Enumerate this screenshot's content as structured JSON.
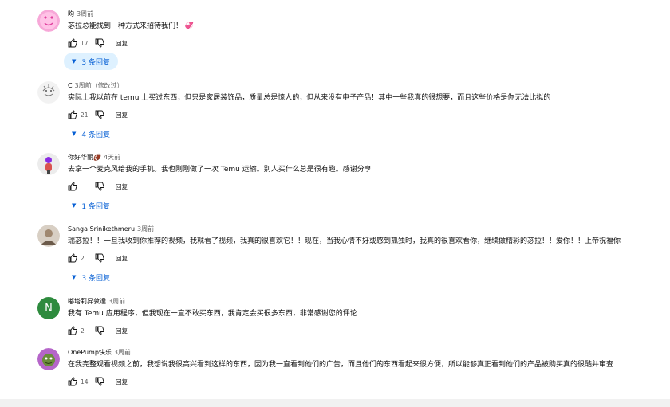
{
  "comments": [
    {
      "author": "昀",
      "time": "3周前",
      "text": "苾拉总能找到一种方式来招待我们！ 💞",
      "likes": "17",
      "reply_label": "回复",
      "replies_label": "3 条回复",
      "avatar_icon": "smiley-face-avatar"
    },
    {
      "author": "C",
      "time": "3周前（修改过）",
      "text": "实际上我以前在 temu 上买过东西，但只是家居装饰品，质量总是惊人的，但从来没有电子产品！其中一些我真的很想要，而且这些价格是你无法比拟的",
      "likes": "21",
      "reply_label": "回复",
      "replies_label": "4 条回复",
      "avatar_icon": "sketch-avatar"
    },
    {
      "author": "你好华丽🏈",
      "time": "4天前",
      "text": "去拿一个麦克风给我的手机。我也刚刚做了一次 Temu 运输。别人买什么总是很有趣。感谢分享",
      "likes": "",
      "reply_label": "回复",
      "replies_label": "1 条回复",
      "avatar_icon": "figure-avatar"
    },
    {
      "author": "Sanga Srinikethmeru",
      "time": "3周前",
      "text": "瑞苾拉！！一旦我收到你推荐的视频，我就看了视频，我真的很喜欢它！！现在，当我心情不好或感到孤独时，我真的很喜欢看你，继续做精彩的苾拉！！爱你！！上帝祝福你",
      "likes": "2",
      "reply_label": "回复",
      "replies_label": "3 条回复",
      "avatar_icon": "photo-avatar"
    },
    {
      "author": "嘟塔莉昇敦達",
      "time": "3周前",
      "text": "我有 Temu 应用程序，但我现在一直不敢买东西，我肯定会买很多东西，非常感谢您的评论",
      "likes": "2",
      "reply_label": "回复",
      "replies_label": "",
      "avatar_icon": "letter-avatar",
      "avatar_letter": "N"
    },
    {
      "author": "OnePump快乐",
      "time": "3周前",
      "text": "在我完整观看视频之前，我想说我很高兴看到这样的东西，因为我一直看到他们的广告，而且他们的东西看起来很方便，所以能够真正看到他们的产品被购买真的很酷并审查",
      "likes": "14",
      "reply_label": "回复",
      "replies_label": "",
      "avatar_icon": "cartoon-avatar"
    }
  ],
  "colors": {
    "link": "#065fd4",
    "active_bg": "#def1ff",
    "meta": "#606060"
  }
}
